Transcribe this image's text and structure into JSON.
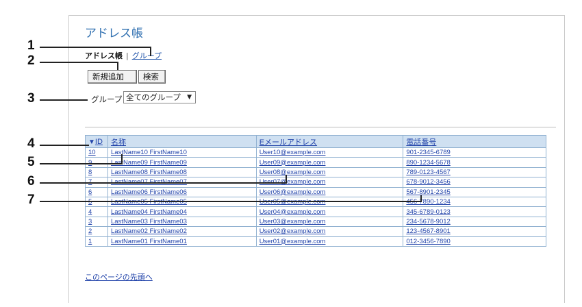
{
  "page": {
    "title": "アドレス帳"
  },
  "subnav": {
    "current": "アドレス帳",
    "separator": "|",
    "group_link": "グループ"
  },
  "buttons": {
    "add": "新規追加",
    "search": "検索"
  },
  "group_filter": {
    "label": "グループ",
    "selected": "全てのグループ"
  },
  "table": {
    "headers": {
      "id": "ID",
      "name": "名称",
      "email": "Eメールアドレス",
      "phone": "電話番号"
    },
    "sort_indicator": "▼",
    "rows": [
      {
        "id": "10",
        "name": "LastName10 FirstName10",
        "email": "User10@example.com",
        "phone": "901-2345-6789"
      },
      {
        "id": "9",
        "name": "LastName09 FirstName09",
        "email": "User09@example.com",
        "phone": "890-1234-5678"
      },
      {
        "id": "8",
        "name": "LastName08 FirstName08",
        "email": "User08@example.com",
        "phone": "789-0123-4567"
      },
      {
        "id": "7",
        "name": "LastName07 FirstName07",
        "email": "User07@example.com",
        "phone": "678-9012-3456"
      },
      {
        "id": "6",
        "name": "LastName06 FirstName06",
        "email": "User06@example.com",
        "phone": "567-8901-2345"
      },
      {
        "id": "5",
        "name": "LastName05 FirstName05",
        "email": "User05@example.com",
        "phone": "456-7890-1234"
      },
      {
        "id": "4",
        "name": "LastName04 FirstName04",
        "email": "User04@example.com",
        "phone": "345-6789-0123"
      },
      {
        "id": "3",
        "name": "LastName03 FirstName03",
        "email": "User03@example.com",
        "phone": "234-5678-9012"
      },
      {
        "id": "2",
        "name": "LastName02 FirstName02",
        "email": "User02@example.com",
        "phone": "123-4567-8901"
      },
      {
        "id": "1",
        "name": "LastName01 FirstName01",
        "email": "User01@example.com",
        "phone": "012-3456-7890"
      }
    ]
  },
  "footer": {
    "top_link": "このページの先頭へ"
  },
  "callouts": [
    "1",
    "2",
    "3",
    "4",
    "5",
    "6",
    "7"
  ]
}
